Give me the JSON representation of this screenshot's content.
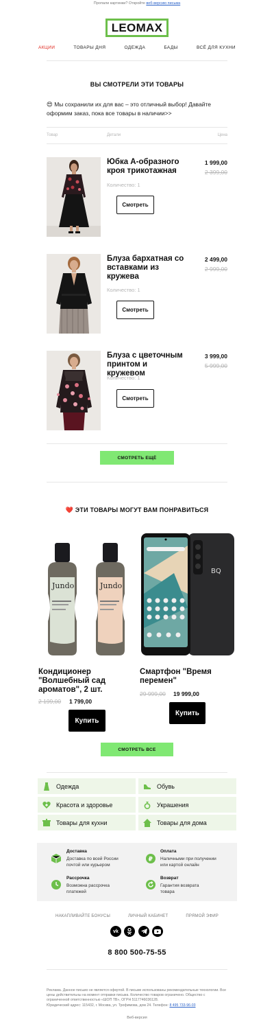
{
  "preheader": {
    "text": "Пропали картинки? Откройте ",
    "link": "веб-версию письма"
  },
  "brand": {
    "logo_text": "LEOMAX",
    "accent": "#6dbf4b"
  },
  "nav": [
    {
      "label": "АКЦИИ",
      "active": true
    },
    {
      "label": "ТОВАРЫ ДНЯ"
    },
    {
      "label": "ОДЕЖДА"
    },
    {
      "label": "БАДЫ"
    },
    {
      "label": "ВСЁ ДЛЯ КУХНИ"
    }
  ],
  "viewed": {
    "title": "ВЫ СМОТРЕЛИ ЭТИ ТОВАРЫ",
    "intro": "😍 Мы сохранили их для вас – это отличный выбор! Давайте оформим заказ, пока все товары в наличии>>",
    "columns": {
      "product": "Товар",
      "details": "Детали",
      "price": "Цена"
    },
    "items": [
      {
        "title": "Юбка А-образного кроя трикотажная",
        "price": "1 999,00",
        "old_price": "2 399,00",
        "qty": "Количество: 1",
        "button": "Смотреть"
      },
      {
        "title": "Блуза бархатная со вставками из кружева",
        "price": "2 499,00",
        "old_price": "2 999,00",
        "qty": "Количество: 1",
        "button": "Смотреть"
      },
      {
        "title": "Блуза с цветочным принтом и кружевом",
        "price": "3 999,00",
        "old_price": "5 999,00",
        "qty": "Количество: 1",
        "button": "Смотреть"
      }
    ],
    "more_button": "СМОТРЕТЬ ЕЩЁ"
  },
  "recommend": {
    "title": "❤️ ЭТИ ТОВАРЫ МОГУТ ВАМ ПОНРАВИТЬСЯ",
    "items": [
      {
        "title": "Кондиционер \"Волшебный сад ароматов\", 2 шт.",
        "old_price": "2 199,00",
        "price": "1 799,00",
        "button": "Купить",
        "bottle_brand": "Jundo"
      },
      {
        "title": "Смартфон \"Время перемен\"",
        "old_price": "29 999,00",
        "price": "19 999,00",
        "button": "Купить",
        "phone_brand": "BQ"
      }
    ],
    "all_button": "СМОТРЕТЬ ВСЕ"
  },
  "categories": [
    {
      "label": "Одежда",
      "icon": "dress-icon"
    },
    {
      "label": "Обувь",
      "icon": "shoe-icon"
    },
    {
      "label": "Красота и здоровье",
      "icon": "heart-plus-icon"
    },
    {
      "label": "Украшения",
      "icon": "ring-icon"
    },
    {
      "label": "Товары для кухни",
      "icon": "pot-icon"
    },
    {
      "label": "Товары для дома",
      "icon": "house-icon"
    }
  ],
  "info": [
    {
      "title": "Доставка",
      "text": "Доставка по всей России почтой или курьером",
      "icon": "box-icon"
    },
    {
      "title": "Оплата",
      "text": "Наличными при получении или картой онлайн",
      "icon": "ruble-icon"
    },
    {
      "title": "Рассрочка",
      "text": "Возможна рассрочка платежей",
      "icon": "clock-icon"
    },
    {
      "title": "Возврат",
      "text": "Гарантия возврата товара",
      "icon": "return-icon"
    }
  ],
  "footer": {
    "links": [
      "НАКАПЛИВАЙТЕ БОНУСЫ",
      "ЛИЧНЫЙ КАБИНЕТ",
      "ПРЯМОЙ ЭФИР"
    ],
    "social": [
      "vk-icon",
      "ok-icon",
      "telegram-icon",
      "youtube-icon"
    ],
    "phone": "8 800 500-75-55",
    "legal_1": "Реклама. Данное письмо не является офертой. В письме использованы рекомендательные технологии. Все цены действительны на момент отправки письма. Количество товаров ограничено. Общество с ограниченной ответственностью «ШОП ТВ», ОГРН 5117746036128.",
    "legal_2": "Юридический адрес: 115432, г. Москва, ул. Трофимова, дом 24. Телефон: ",
    "legal_phone": "8 495 733-96-03",
    "web_version": "Веб-версия"
  },
  "colors": {
    "green": "#80e873",
    "category_bg": "#eef6e8",
    "red": "#e0251b"
  }
}
